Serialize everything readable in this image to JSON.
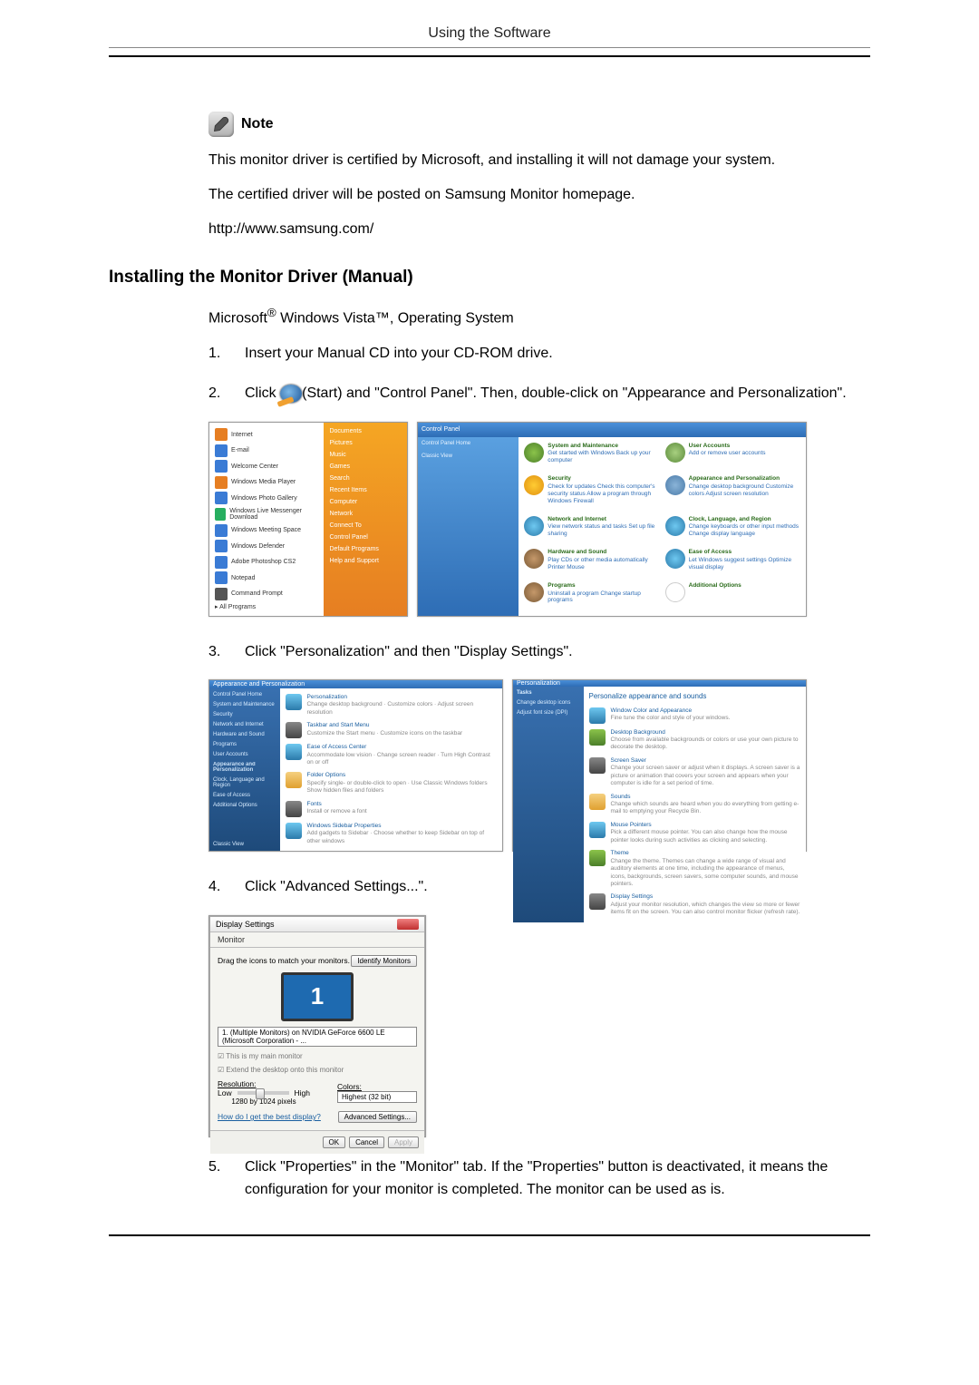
{
  "header": "Using the Software",
  "note": {
    "label": "Note",
    "p1": "This monitor driver is certified by Microsoft, and installing it will not damage your system.",
    "p2": "The certified driver will be posted on Samsung Monitor homepage.",
    "p3": "http://www.samsung.com/"
  },
  "section_title": "Installing the Monitor Driver (Manual)",
  "os_line": {
    "microsoft": "Microsoft",
    "reg": "®",
    "rest": " Windows Vista™, Operating System"
  },
  "steps": {
    "s1": {
      "n": "1.",
      "t": "Insert your Manual CD into your CD-ROM drive."
    },
    "s2": {
      "n": "2.",
      "pre": "Click ",
      "post": "(Start) and \"Control Panel\". Then, double-click on \"Appearance and Personalization\"."
    },
    "s3": {
      "n": "3.",
      "t": "Click \"Personalization\" and then \"Display Settings\"."
    },
    "s4": {
      "n": "4.",
      "t": "Click \"Advanced Settings...\"."
    },
    "s5": {
      "n": "5.",
      "t": "Click \"Properties\" in the \"Monitor\" tab. If the \"Properties\" button is deactivated, it means the configuration for your monitor is completed. The monitor can be used as is."
    }
  },
  "start_menu": {
    "items": [
      "Internet",
      "E-mail",
      "Welcome Center",
      "Windows Media Player",
      "Windows Photo Gallery",
      "Windows Live Messenger Download",
      "Windows Meeting Space",
      "Windows Defender",
      "Adobe Photoshop CS2",
      "Notepad",
      "Command Prompt"
    ],
    "all": "All Programs",
    "right": [
      "Documents",
      "Pictures",
      "Music",
      "Games",
      "Search",
      "Recent Items",
      "Computer",
      "Network",
      "Connect To",
      "Control Panel",
      "Default Programs",
      "Help and Support"
    ]
  },
  "control_panel": {
    "bar": "Control Panel",
    "side": {
      "home": "Control Panel Home",
      "classic": "Classic View"
    },
    "cats": {
      "sys": {
        "h": "System and Maintenance",
        "s": "Get started with Windows\nBack up your computer"
      },
      "sec": {
        "h": "Security",
        "s": "Check for updates\nCheck this computer's security status\nAllow a program through Windows Firewall"
      },
      "net": {
        "h": "Network and Internet",
        "s": "View network status and tasks\nSet up file sharing"
      },
      "hw": {
        "h": "Hardware and Sound",
        "s": "Play CDs or other media automatically\nPrinter\nMouse"
      },
      "prog": {
        "h": "Programs",
        "s": "Uninstall a program\nChange startup programs"
      },
      "user": {
        "h": "User Accounts",
        "s": "Add or remove user accounts"
      },
      "appear": {
        "h": "Appearance and Personalization",
        "s": "Change desktop background\nCustomize colors\nAdjust screen resolution"
      },
      "clock": {
        "h": "Clock, Language, and Region",
        "s": "Change keyboards or other input methods\nChange display language"
      },
      "ease": {
        "h": "Ease of Access",
        "s": "Let Windows suggest settings\nOptimize visual display"
      },
      "addl": {
        "h": "Additional Options",
        "s": ""
      }
    }
  },
  "appear_panel": {
    "bar": "Appearance and Personalization",
    "side": [
      "Control Panel Home",
      "System and Maintenance",
      "Security",
      "Network and Internet",
      "Hardware and Sound",
      "Programs",
      "User Accounts",
      "Appearance and Personalization",
      "Clock, Language and Region",
      "Ease of Access",
      "Additional Options",
      "Classic View"
    ],
    "rows": {
      "pers": {
        "h": "Personalization",
        "s": "Change desktop background · Customize colors · Adjust screen resolution"
      },
      "task": {
        "h": "Taskbar and Start Menu",
        "s": "Customize the Start menu · Customize icons on the taskbar"
      },
      "ease": {
        "h": "Ease of Access Center",
        "s": "Accommodate low vision · Change screen reader · Turn High Contrast on or off"
      },
      "fold": {
        "h": "Folder Options",
        "s": "Specify single- or double-click to open · Use Classic Windows folders\nShow hidden files and folders"
      },
      "font": {
        "h": "Fonts",
        "s": "Install or remove a font"
      },
      "side": {
        "h": "Windows Sidebar Properties",
        "s": "Add gadgets to Sidebar · Choose whether to keep Sidebar on top of other windows"
      }
    }
  },
  "pers_panel": {
    "bar": "Personalization",
    "title": "Personalize appearance and sounds",
    "side": [
      "Tasks",
      "Change desktop icons",
      "Adjust font size (DPI)"
    ],
    "rows": {
      "wc": {
        "h": "Window Color and Appearance",
        "s": "Fine tune the color and style of your windows."
      },
      "db": {
        "h": "Desktop Background",
        "s": "Choose from available backgrounds or colors or use your own picture to decorate the desktop."
      },
      "ss": {
        "h": "Screen Saver",
        "s": "Change your screen saver or adjust when it displays. A screen saver is a picture or animation that covers your screen and appears when your computer is idle for a set period of time."
      },
      "so": {
        "h": "Sounds",
        "s": "Change which sounds are heard when you do everything from getting e-mail to emptying your Recycle Bin."
      },
      "mp": {
        "h": "Mouse Pointers",
        "s": "Pick a different mouse pointer. You can also change how the mouse pointer looks during such activities as clicking and selecting."
      },
      "th": {
        "h": "Theme",
        "s": "Change the theme. Themes can change a wide range of visual and auditory elements at one time, including the appearance of menus, icons, backgrounds, screen savers, some computer sounds, and mouse pointers."
      },
      "ds": {
        "h": "Display Settings",
        "s": "Adjust your monitor resolution, which changes the view so more or fewer items fit on the screen. You can also control monitor flicker (refresh rate)."
      }
    }
  },
  "display_settings": {
    "title": "Display Settings",
    "tab": "Monitor",
    "drag": "Drag the icons to match your monitors.",
    "identify": "Identify Monitors",
    "big": "1",
    "sel": "1. (Multiple Monitors) on NVIDIA GeForce 6600 LE (Microsoft Corporation - ...",
    "chk1": "This is my main monitor",
    "chk2": "Extend the desktop onto this monitor",
    "res": "Resolution:",
    "low": "Low",
    "high": "High",
    "resval": "1280 by 1024 pixels",
    "colors": "Colors:",
    "colorval": "Highest (32 bit)",
    "help": "How do I get the best display?",
    "adv": "Advanced Settings...",
    "ok": "OK",
    "cancel": "Cancel",
    "apply": "Apply"
  }
}
